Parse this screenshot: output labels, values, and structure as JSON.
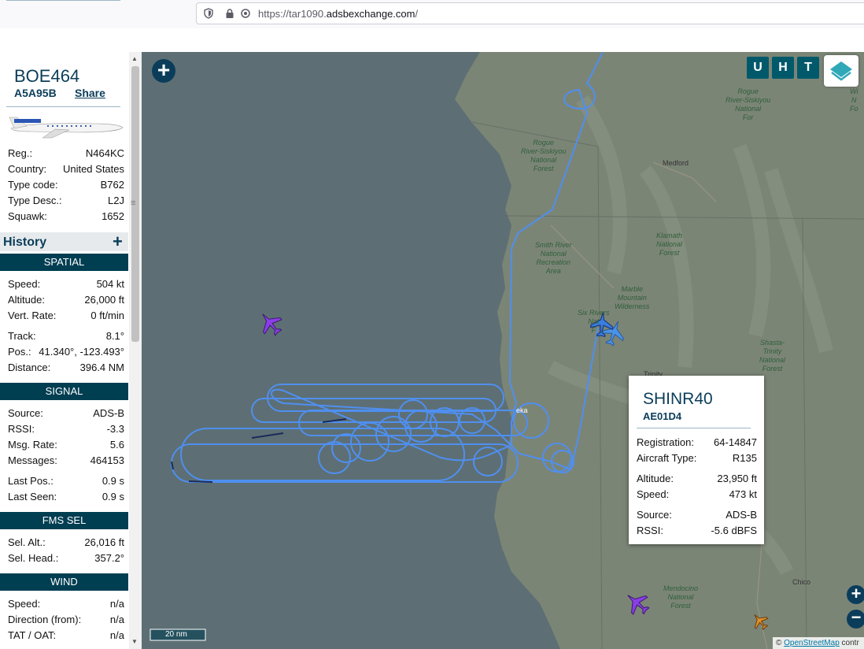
{
  "browser": {
    "url_prefix": "https://tar1090.",
    "url_domain": "adsbexchange.com",
    "url_suffix": "/"
  },
  "selected": {
    "callsign": "BOE464",
    "hex": "A5A95B",
    "share_label": "Share",
    "info": [
      {
        "k": "Reg.:",
        "v": "N464KC"
      },
      {
        "k": "Country:",
        "v": "United States"
      },
      {
        "k": "Type code:",
        "v": "B762"
      },
      {
        "k": "Type Desc.:",
        "v": "L2J"
      },
      {
        "k": "Squawk:",
        "v": "1652"
      }
    ],
    "history_label": "History",
    "sections": {
      "spatial": {
        "title": "SPATIAL",
        "rows": [
          {
            "k": "Speed:",
            "v": "504 kt"
          },
          {
            "k": "Altitude:",
            "v": "26,000 ft"
          },
          {
            "k": "Vert. Rate:",
            "v": "0 ft/min"
          },
          {
            "k": "Track:",
            "v": "8.1°"
          },
          {
            "k": "Pos.:",
            "v": "41.340°, -123.493°"
          },
          {
            "k": "Distance:",
            "v": "396.4 NM"
          }
        ]
      },
      "signal": {
        "title": "SIGNAL",
        "rows": [
          {
            "k": "Source:",
            "v": "ADS-B"
          },
          {
            "k": "RSSI:",
            "v": "-3.3"
          },
          {
            "k": "Msg. Rate:",
            "v": "5.6"
          },
          {
            "k": "Messages:",
            "v": "464153"
          },
          {
            "k": "Last Pos.:",
            "v": "0.9 s"
          },
          {
            "k": "Last Seen:",
            "v": "0.9 s"
          }
        ]
      },
      "fms": {
        "title": "FMS SEL",
        "rows": [
          {
            "k": "Sel. Alt.:",
            "v": "26,016 ft"
          },
          {
            "k": "Sel. Head.:",
            "v": "357.2°"
          }
        ]
      },
      "wind": {
        "title": "WIND",
        "rows": [
          {
            "k": "Speed:",
            "v": "n/a"
          },
          {
            "k": "Direction (from):",
            "v": "n/a"
          },
          {
            "k": "TAT / OAT:",
            "v": "n/a"
          }
        ]
      }
    }
  },
  "map": {
    "buttons": {
      "u": "U",
      "h": "H",
      "t": "T"
    },
    "scale_label": "20 nm",
    "attribution_prefix": "©",
    "attribution_link": "OpenStreetMap",
    "attribution_suffix": "contr",
    "places": {
      "rogue": "Rogue\nRiver-Siskiyou\nNational\nForest",
      "rogue2": "Rogue\nRiver-Siskiyou\nNational\nFor",
      "medford": "Medford",
      "klamath": "Klamath\nNational\nForest",
      "smith": "Smith River\nNational\nRecreation\nArea",
      "marble": "Marble\nMountain\nWilderness",
      "sixrivers": "Six Rivers\nNat\nF",
      "shasta": "Shasta-\nTrinity\nNational\nForest",
      "trinity": "Trinity",
      "eureka": "eka",
      "mendocino": "Mendocino\nNational\nForest",
      "chico": "Chico",
      "wi": "Wi\nN\nFo"
    },
    "colors": {
      "ocean": "#5d6f74",
      "land": "#7c8677",
      "track": "#4f8ff0",
      "selected_plane": "#3a7ee0",
      "purple_plane": "#8a3ee8",
      "orange_plane": "#e0902a",
      "header": "#003e52"
    }
  },
  "popup": {
    "callsign": "SHINR40",
    "hex": "AE01D4",
    "rows": [
      {
        "k": "Registration:",
        "v": "64-14847"
      },
      {
        "k": "Aircraft Type:",
        "v": "R135"
      },
      {
        "k": "Altitude:",
        "v": "23,950 ft"
      },
      {
        "k": "Speed:",
        "v": "473 kt"
      },
      {
        "k": "Source:",
        "v": "ADS-B"
      },
      {
        "k": "RSSI:",
        "v": "-5.6 dBFS"
      }
    ]
  }
}
